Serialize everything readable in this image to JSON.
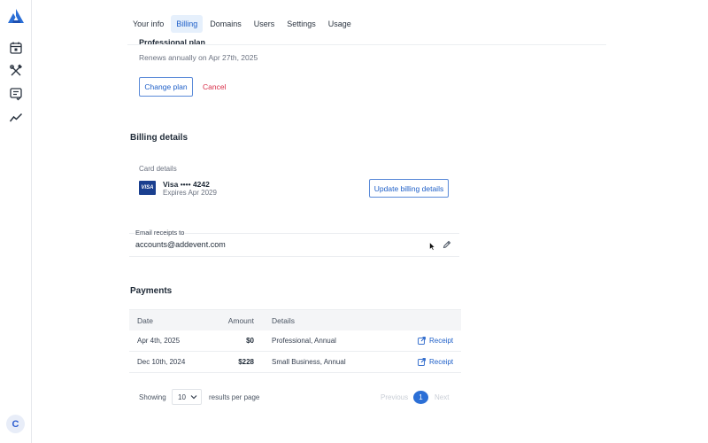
{
  "sidebar": {
    "icons": [
      "logo-icon",
      "calendar-icon",
      "tools-icon",
      "checklist-icon",
      "analytics-icon"
    ],
    "avatar_initial": "C"
  },
  "tabs": [
    {
      "label": "Your info",
      "active": false
    },
    {
      "label": "Billing",
      "active": true
    },
    {
      "label": "Domains",
      "active": false
    },
    {
      "label": "Users",
      "active": false
    },
    {
      "label": "Settings",
      "active": false
    },
    {
      "label": "Usage",
      "active": false
    }
  ],
  "plan": {
    "title": "Professional plan",
    "renews": "Renews annually on Apr 27th, 2025",
    "change_label": "Change plan",
    "cancel_label": "Cancel"
  },
  "billing": {
    "heading": "Billing details",
    "card_label": "Card details",
    "card_brand_badge": "VISA",
    "card_line": "Visa  ••••  4242",
    "card_expires": "Expires Apr 2029",
    "update_label": "Update billing details",
    "email_label": "Email receipts to",
    "email_value": "accounts@addevent.com"
  },
  "payments": {
    "heading": "Payments",
    "columns": {
      "date": "Date",
      "amount": "Amount",
      "details": "Details"
    },
    "rows": [
      {
        "date": "Apr 4th, 2025",
        "amount": "$0",
        "details": "Professional, Annual",
        "receipt": "Receipt"
      },
      {
        "date": "Dec 10th, 2024",
        "amount": "$228",
        "details": "Small Business, Annual",
        "receipt": "Receipt"
      }
    ]
  },
  "pagination": {
    "showing": "Showing",
    "per_page_value": "10",
    "results_per_page": "results per page",
    "previous": "Previous",
    "current_page": "1",
    "next": "Next"
  },
  "colors": {
    "accent": "#2b6fd6",
    "danger": "#d9304a",
    "visa": "#1a3f8f"
  }
}
